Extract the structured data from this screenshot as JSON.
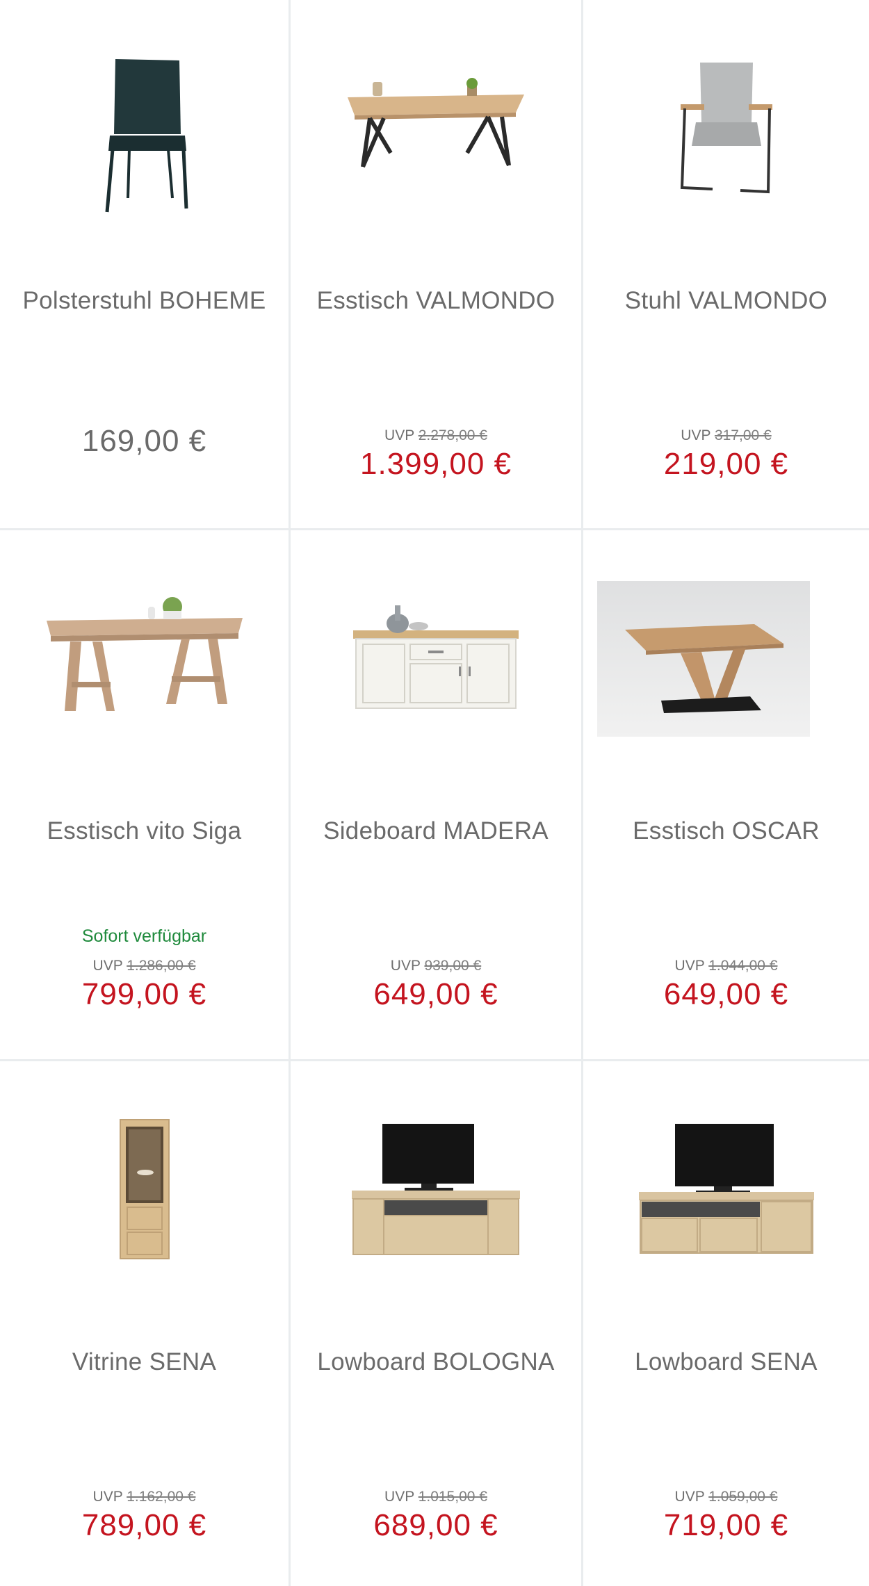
{
  "products": [
    {
      "name": "Polsterstuhl BOHEME",
      "uvp_label": "",
      "uvp_price": "",
      "price": "169,00 €",
      "availability": "",
      "image": "dining-chair-dark-green"
    },
    {
      "name": "Esstisch VALMONDO",
      "uvp_label": "UVP",
      "uvp_price": "2.278,00 €",
      "price": "1.399,00 €",
      "availability": "",
      "image": "dining-table-black-legs"
    },
    {
      "name": "Stuhl VALMONDO",
      "uvp_label": "UVP",
      "uvp_price": "317,00 €",
      "price": "219,00 €",
      "availability": "",
      "image": "armchair-grey"
    },
    {
      "name": "Esstisch vito Siga",
      "uvp_label": "UVP",
      "uvp_price": "1.286,00 €",
      "price": "799,00 €",
      "availability": "Sofort verfügbar",
      "image": "wooden-dining-table"
    },
    {
      "name": "Sideboard MADERA",
      "uvp_label": "UVP",
      "uvp_price": "939,00 €",
      "price": "649,00 €",
      "availability": "",
      "image": "white-sideboard"
    },
    {
      "name": "Esstisch OSCAR",
      "uvp_label": "UVP",
      "uvp_price": "1.044,00 €",
      "price": "649,00 €",
      "availability": "",
      "image": "pedestal-dining-table"
    },
    {
      "name": "Vitrine SENA",
      "uvp_label": "UVP",
      "uvp_price": "1.162,00 €",
      "price": "789,00 €",
      "availability": "",
      "image": "display-cabinet"
    },
    {
      "name": "Lowboard BOLOGNA",
      "uvp_label": "UVP",
      "uvp_price": "1.015,00 €",
      "price": "689,00 €",
      "availability": "",
      "image": "tv-lowboard"
    },
    {
      "name": "Lowboard SENA",
      "uvp_label": "UVP",
      "uvp_price": "1.059,00 €",
      "price": "719,00 €",
      "availability": "",
      "image": "tv-lowboard"
    }
  ],
  "colors": {
    "price_sale": "#c4141f",
    "price_regular": "#6a6a6a",
    "availability": "#1f8a3c",
    "divider": "#e9ecee"
  }
}
